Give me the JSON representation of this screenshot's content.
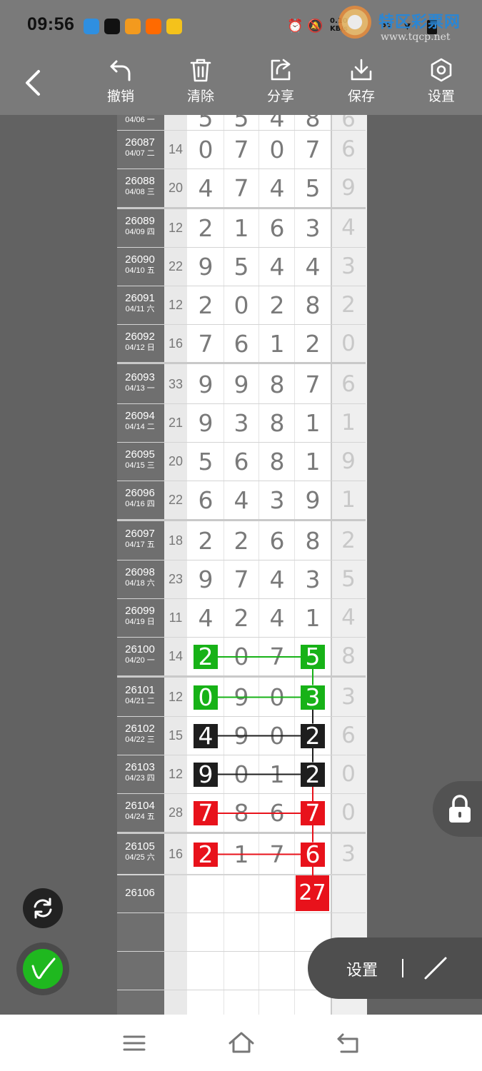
{
  "status": {
    "time": "09:56",
    "net_speed": "0.10",
    "net_unit": "KB/s",
    "net_5g": "5G"
  },
  "watermark": {
    "title": "特区彩票网",
    "url": "www.tqcp.net"
  },
  "toolbar": {
    "undo_label": "撤销",
    "clear_label": "清除",
    "share_label": "分享",
    "save_label": "保存",
    "settings_label": "设置"
  },
  "partial_top_row": {
    "date": "04/06 一",
    "digits": [
      "5",
      "5",
      "4",
      "8"
    ],
    "tail": "6"
  },
  "rows": [
    {
      "issue": "26087",
      "date": "04/07 二",
      "sum": "14",
      "digits": [
        "0",
        "7",
        "0",
        "7"
      ],
      "tail": "6"
    },
    {
      "issue": "26088",
      "date": "04/08 三",
      "sum": "20",
      "digits": [
        "4",
        "7",
        "4",
        "5"
      ],
      "tail": "9"
    },
    {
      "issue": "26089",
      "date": "04/09 四",
      "sum": "12",
      "digits": [
        "2",
        "1",
        "6",
        "3"
      ],
      "tail": "4"
    },
    {
      "issue": "26090",
      "date": "04/10 五",
      "sum": "22",
      "digits": [
        "9",
        "5",
        "4",
        "4"
      ],
      "tail": "3"
    },
    {
      "issue": "26091",
      "date": "04/11 六",
      "sum": "12",
      "digits": [
        "2",
        "0",
        "2",
        "8"
      ],
      "tail": "2"
    },
    {
      "issue": "26092",
      "date": "04/12 日",
      "sum": "16",
      "digits": [
        "7",
        "6",
        "1",
        "2"
      ],
      "tail": "0"
    },
    {
      "issue": "26093",
      "date": "04/13 一",
      "sum": "33",
      "digits": [
        "9",
        "9",
        "8",
        "7"
      ],
      "tail": "6"
    },
    {
      "issue": "26094",
      "date": "04/14 二",
      "sum": "21",
      "digits": [
        "9",
        "3",
        "8",
        "1"
      ],
      "tail": "1"
    },
    {
      "issue": "26095",
      "date": "04/15 三",
      "sum": "20",
      "digits": [
        "5",
        "6",
        "8",
        "1"
      ],
      "tail": "9"
    },
    {
      "issue": "26096",
      "date": "04/16 四",
      "sum": "22",
      "digits": [
        "6",
        "4",
        "3",
        "9"
      ],
      "tail": "1"
    },
    {
      "issue": "26097",
      "date": "04/17 五",
      "sum": "18",
      "digits": [
        "2",
        "2",
        "6",
        "8"
      ],
      "tail": "2"
    },
    {
      "issue": "26098",
      "date": "04/18 六",
      "sum": "23",
      "digits": [
        "9",
        "7",
        "4",
        "3"
      ],
      "tail": "5"
    },
    {
      "issue": "26099",
      "date": "04/19 日",
      "sum": "11",
      "digits": [
        "4",
        "2",
        "4",
        "1"
      ],
      "tail": "4"
    },
    {
      "issue": "26100",
      "date": "04/20 一",
      "sum": "14",
      "digits": [
        "2",
        "0",
        "7",
        "5"
      ],
      "tail": "8",
      "mark": "green"
    },
    {
      "issue": "26101",
      "date": "04/21 二",
      "sum": "12",
      "digits": [
        "0",
        "9",
        "0",
        "3"
      ],
      "tail": "3",
      "mark": "green"
    },
    {
      "issue": "26102",
      "date": "04/22 三",
      "sum": "15",
      "digits": [
        "4",
        "9",
        "0",
        "2"
      ],
      "tail": "6",
      "mark": "black"
    },
    {
      "issue": "26103",
      "date": "04/23 四",
      "sum": "12",
      "digits": [
        "9",
        "0",
        "1",
        "2"
      ],
      "tail": "0",
      "mark": "black"
    },
    {
      "issue": "26104",
      "date": "04/24 五",
      "sum": "28",
      "digits": [
        "7",
        "8",
        "6",
        "7"
      ],
      "tail": "0",
      "mark": "red"
    },
    {
      "issue": "26105",
      "date": "04/25 六",
      "sum": "16",
      "digits": [
        "2",
        "1",
        "7",
        "6"
      ],
      "tail": "3",
      "mark": "red"
    }
  ],
  "next_issue": "26106",
  "prediction": "27",
  "floating_panel": {
    "settings_label": "设置"
  },
  "colors": {
    "green": "#17b217",
    "black": "#1e1e1e",
    "red": "#e8121b"
  },
  "icons": {
    "back": "chevron-left-icon",
    "undo": "undo-icon",
    "clear": "trash-icon",
    "share": "share-icon",
    "save": "download-icon",
    "settings": "gear-icon",
    "refresh": "refresh-icon",
    "pen": "pen-icon",
    "lock": "lock-icon"
  }
}
